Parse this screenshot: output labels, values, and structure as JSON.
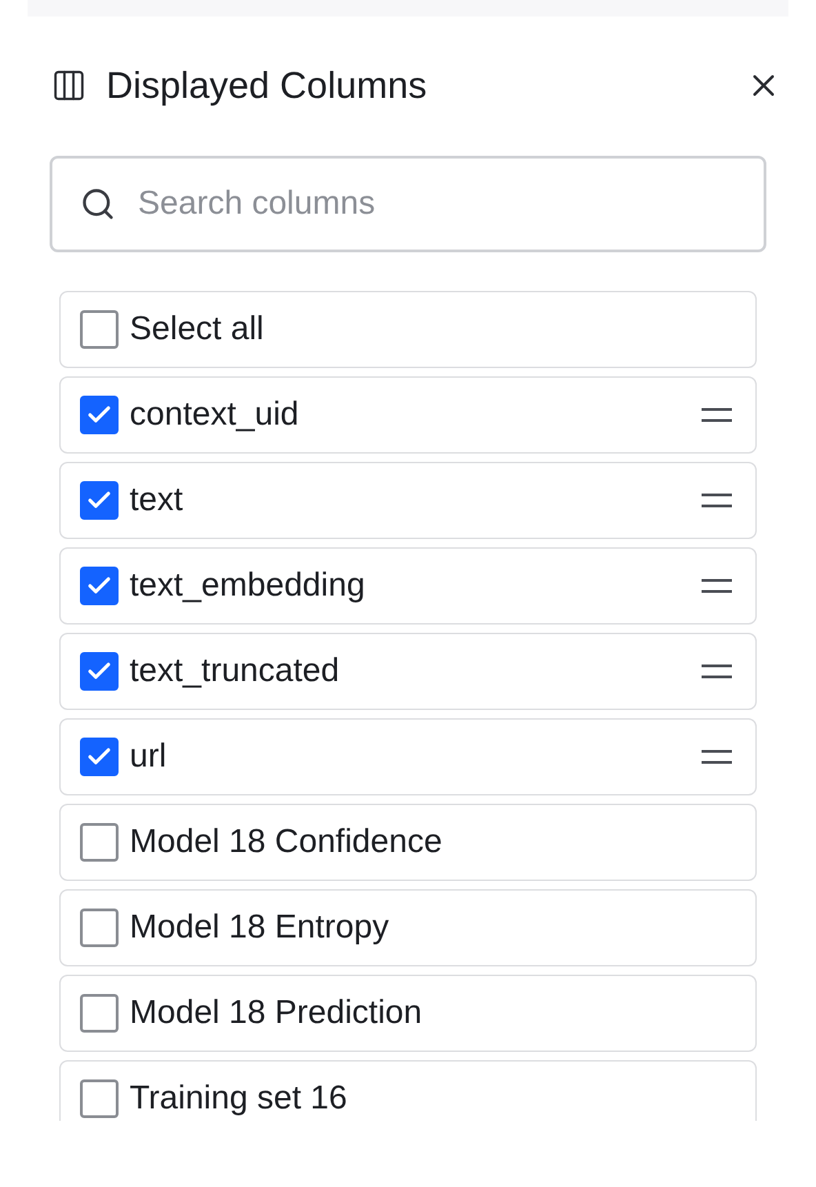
{
  "panel": {
    "title": "Displayed Columns"
  },
  "search": {
    "placeholder": "Search columns"
  },
  "select_all": {
    "label": "Select all",
    "checked": false
  },
  "columns": [
    {
      "label": "context_uid",
      "checked": true
    },
    {
      "label": "text",
      "checked": true
    },
    {
      "label": "text_embedding",
      "checked": true
    },
    {
      "label": "text_truncated",
      "checked": true
    },
    {
      "label": "url",
      "checked": true
    },
    {
      "label": "Model 18 Confidence",
      "checked": false
    },
    {
      "label": "Model 18 Entropy",
      "checked": false
    },
    {
      "label": "Model 18 Prediction",
      "checked": false
    },
    {
      "label": "Training set 16",
      "checked": false
    }
  ]
}
